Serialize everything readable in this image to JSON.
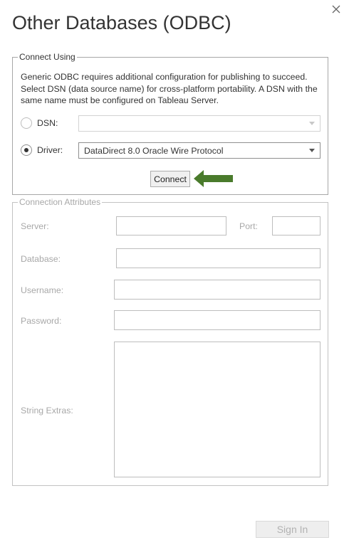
{
  "dialog": {
    "title": "Other Databases (ODBC)",
    "close_icon": "close-icon"
  },
  "connect_using": {
    "legend": "Connect Using",
    "description": "Generic ODBC requires additional configuration for publishing to succeed. Select DSN (data source name) for cross-platform portability. A DSN with the same name must be configured on Tableau Server.",
    "dsn": {
      "label": "DSN:",
      "selected": false,
      "value": ""
    },
    "driver": {
      "label": "Driver:",
      "selected": true,
      "value": "DataDirect 8.0 Oracle Wire Protocol"
    },
    "connect_button": "Connect",
    "annotation_arrow": {
      "icon": "arrow-left-icon",
      "color": "#4a7b2c"
    }
  },
  "connection_attributes": {
    "legend": "Connection Attributes",
    "server_label": "Server:",
    "port_label": "Port:",
    "database_label": "Database:",
    "username_label": "Username:",
    "password_label": "Password:",
    "string_extras_label": "String Extras:"
  },
  "footer": {
    "sign_in_button": "Sign In"
  },
  "colors": {
    "text": "#333333",
    "disabled_text": "#a8a8a8",
    "border": "#a7a7a7",
    "arrow_green": "#4a7b2c"
  }
}
